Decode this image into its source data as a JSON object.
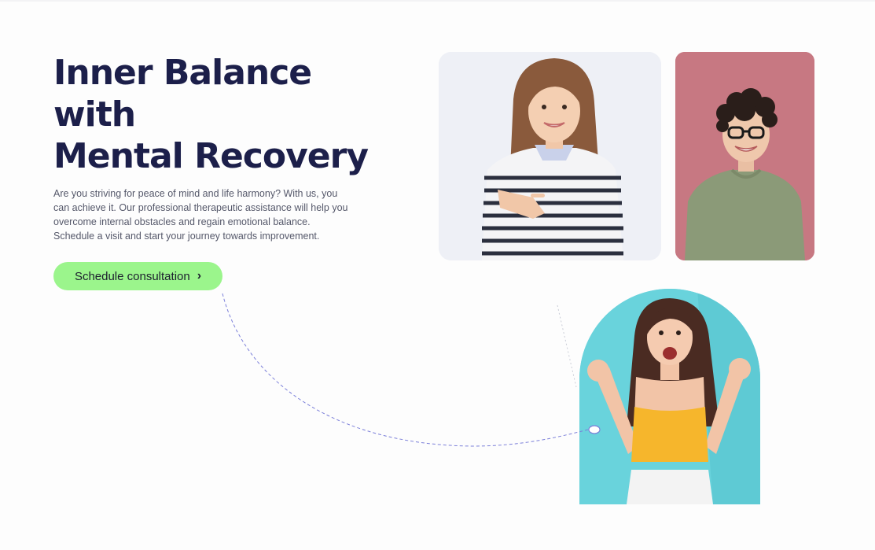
{
  "hero": {
    "title_lines": [
      "Inner Balance",
      "with",
      "Mental Recovery"
    ],
    "description": "Are you striving for peace of mind and life harmony? With us, you can achieve it. Our professional therapeutic assistance will help you overcome internal obstacles and regain emotional balance. Schedule a visit and start your journey towards improvement.",
    "cta_label": "Schedule consultation",
    "cta_icon": "chevron-right-icon"
  },
  "photos": [
    {
      "name": "woman-pointing-photo"
    },
    {
      "name": "man-glasses-photo"
    },
    {
      "name": "woman-celebrating-photo"
    }
  ],
  "colors": {
    "title": "#1c1f4a",
    "body_text": "#55586a",
    "cta_background": "#9bf58c",
    "connector_line": "#7b7fd9",
    "card_pink": "#c77882",
    "card_teal": "#69d3dc"
  }
}
